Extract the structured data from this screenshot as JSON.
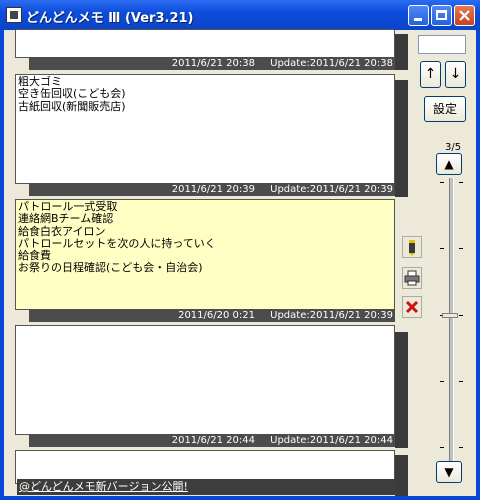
{
  "window": {
    "title": "どんどんメモ Ⅲ (Ver3.21)"
  },
  "memos": [
    {
      "text": "",
      "created": "2011/6/21 20:38",
      "update": "Update:2011/6/21 20:38"
    },
    {
      "text": "粗大ゴミ\n空き缶回収(こども会)\n古紙回収(新聞販売店)",
      "created": "2011/6/21 20:39",
      "update": "Update:2011/6/21 20:39"
    },
    {
      "text": "パトロール一式受取\n連絡網Bチーム確認\n給食白衣アイロン\nパトロールセットを次の人に持っていく\n給食費\nお祭りの日程確認(こども会・自治会)",
      "created": "2011/6/20 0:21",
      "update": "Update:2011/6/21 20:39"
    },
    {
      "text": "",
      "created": "2011/6/21 20:44",
      "update": "Update:2011/6/21 20:44"
    }
  ],
  "memo_actions": {
    "edit_icon": "pen-icon",
    "print_icon": "printer-icon",
    "delete_icon": "delete-x-icon"
  },
  "controls": {
    "up_icon": "↑",
    "down_icon": "↓",
    "settings_label": "設定",
    "page_indicator": "3/5",
    "scroll_up_icon": "▲",
    "scroll_down_icon": "▼"
  },
  "status": {
    "text": "@どんどんメモ新バージョン公開!"
  }
}
